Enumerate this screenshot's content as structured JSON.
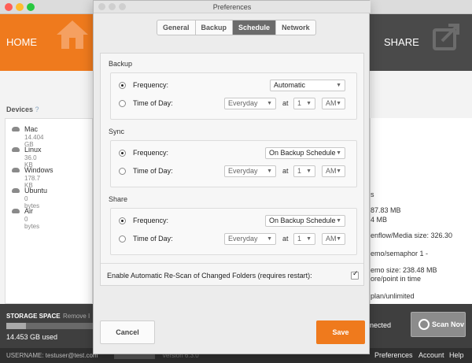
{
  "app": {
    "home_tab": "HOME",
    "share_tab": "SHARE",
    "devices_title": "Devices",
    "devices_help": "?",
    "devices": [
      {
        "name": "Mac",
        "size": "14.404 GB"
      },
      {
        "name": "Linux",
        "size": "36.0 KB"
      },
      {
        "name": "Windows",
        "size": "178.7 KB"
      },
      {
        "name": "Ubuntu",
        "size": "0 bytes"
      },
      {
        "name": "Air",
        "size": "0 bytes"
      }
    ],
    "right_panel_lines": [
      "s",
      "87.83 MB",
      "4 MB",
      "enflow/Media size: 326.30",
      "emo/semaphor 1 -",
      "emo size: 238.48 MB",
      "ore/point in time",
      "plan/unlimited"
    ],
    "footer": {
      "storage_label": "STORAGE SPACE",
      "remove_label": "Remove I",
      "storage_used": "14.453 GB used",
      "storage_fraction": 0.22,
      "connected": "nected",
      "scan_button": "Scan Nov"
    },
    "status_bar": {
      "username": "USERNAME: testuser@test.com",
      "version": "Version 6.3.0",
      "preferences": "Preferences",
      "account": "Account",
      "help": "Help"
    }
  },
  "dialog": {
    "title": "Preferences",
    "tabs": [
      "General",
      "Backup",
      "Schedule",
      "Network"
    ],
    "active_tab": "Schedule",
    "sections": [
      {
        "title": "Backup",
        "frequency_label": "Frequency:",
        "frequency_value": "Automatic",
        "time_label": "Time of Day:",
        "day_value": "Everyday",
        "at_label": "at",
        "hour_value": "1",
        "ampm_value": "AM"
      },
      {
        "title": "Sync",
        "frequency_label": "Frequency:",
        "frequency_value": "On Backup Schedule",
        "time_label": "Time of Day:",
        "day_value": "Everyday",
        "at_label": "at",
        "hour_value": "1",
        "ampm_value": "AM"
      },
      {
        "title": "Share",
        "frequency_label": "Frequency:",
        "frequency_value": "On Backup Schedule",
        "time_label": "Time of Day:",
        "day_value": "Everyday",
        "at_label": "at",
        "hour_value": "1",
        "ampm_value": "AM"
      }
    ],
    "rescan_label": "Enable Automatic Re-Scan of Changed Folders (requires restart):",
    "rescan_checked": true,
    "cancel_button": "Cancel",
    "save_button": "Save"
  },
  "colors": {
    "accent": "#ef7a1d",
    "header_dark": "#4a4a4a",
    "footer_dark": "#3f3f3f"
  }
}
